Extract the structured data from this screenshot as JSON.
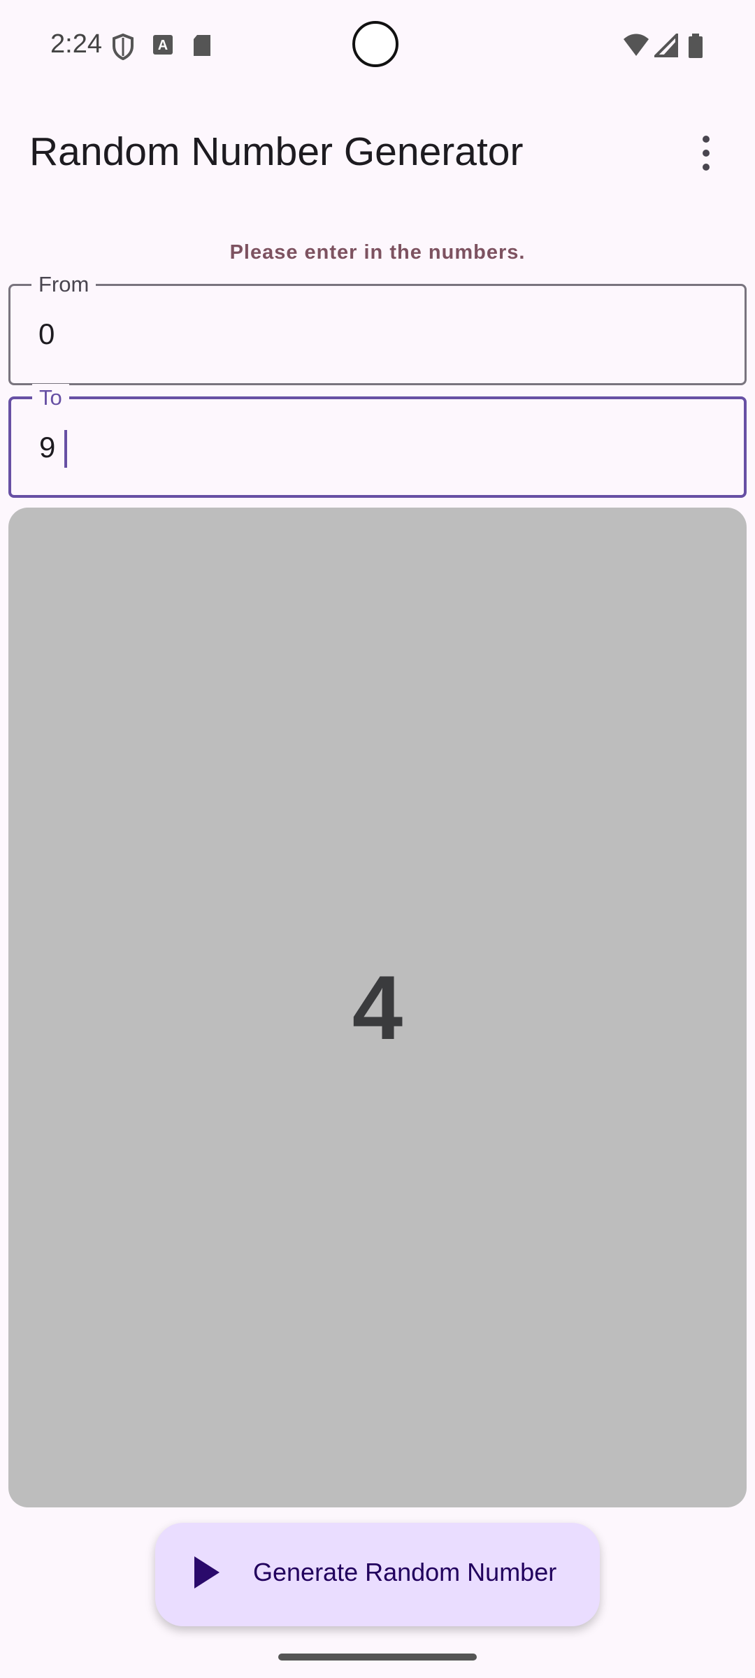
{
  "status_bar": {
    "time": "2:24",
    "left_icons": [
      "vpn-shield-icon",
      "font-a-icon",
      "sd-card-icon"
    ],
    "right_icons": [
      "wifi-icon",
      "cellular-signal-icon",
      "battery-icon"
    ]
  },
  "app_bar": {
    "title": "Random Number Generator",
    "menu_icon": "more-vert-icon"
  },
  "instructions": "Please enter in the numbers.",
  "from_field": {
    "label": "From",
    "value": "0"
  },
  "to_field": {
    "label": "To",
    "value": "9",
    "focused": true
  },
  "result": {
    "value": "4"
  },
  "fab": {
    "label": "Generate Random Number",
    "icon": "play-icon"
  },
  "colors": {
    "background": "#fdf7fd",
    "accent": "#6750a4",
    "instructions_text": "#7d5260",
    "result_card": "#bdbdbd",
    "fab_background": "#eaddff"
  }
}
